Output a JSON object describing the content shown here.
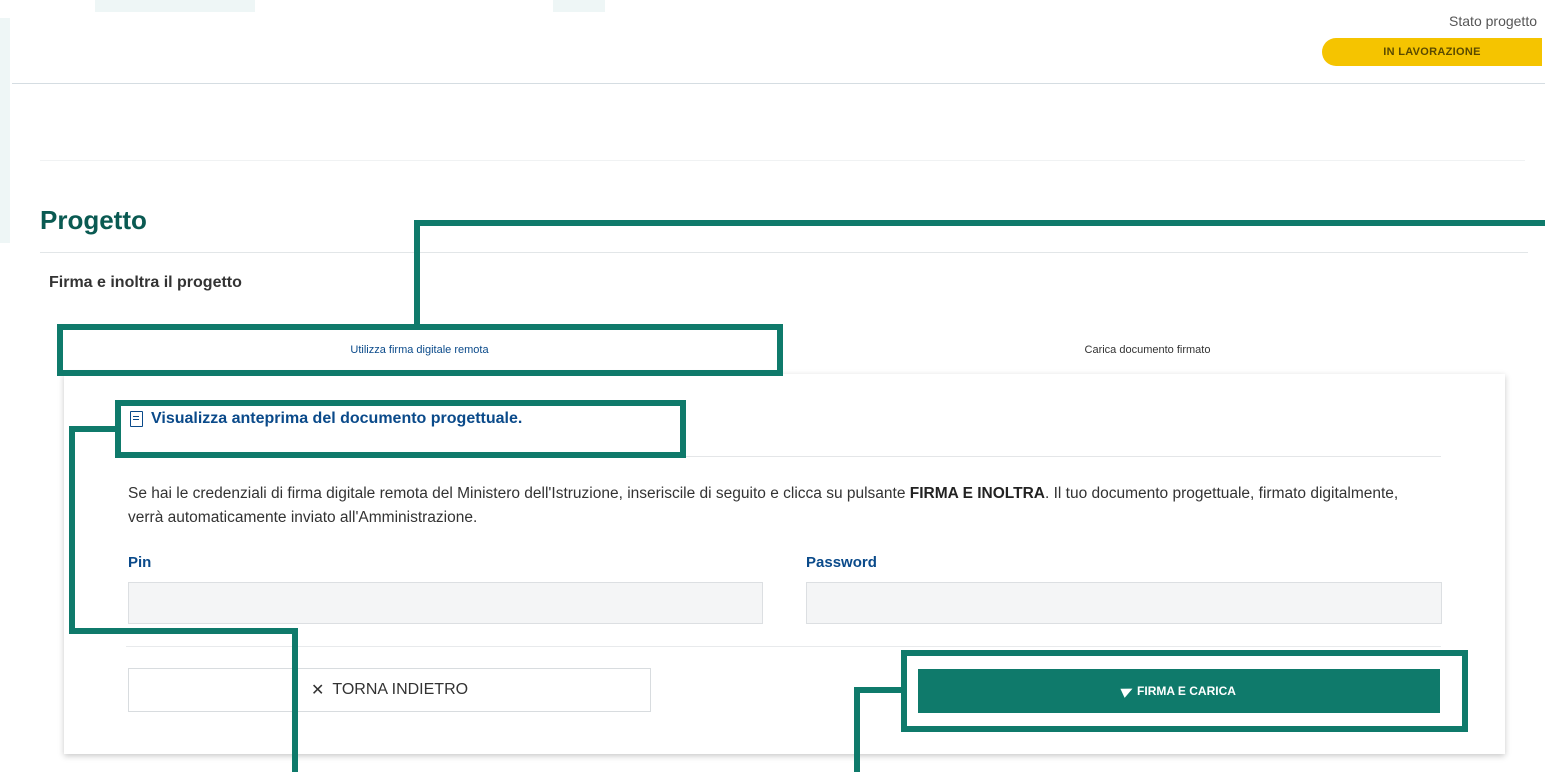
{
  "header": {
    "stato_label": "Stato progetto",
    "stato_value": "IN LAVORAZIONE",
    "stato_color": "#f5c400"
  },
  "page": {
    "title": "Progetto",
    "subtitle": "Firma e inoltra il progetto"
  },
  "tabs": [
    {
      "label": "Utilizza firma digitale remota",
      "active": true
    },
    {
      "label": "Carica documento firmato",
      "active": false
    }
  ],
  "card": {
    "preview_icon": "document-icon",
    "preview_link": "Visualizza anteprima del documento progettuale.",
    "description": {
      "part1": "Se hai le credenziali di firma digitale remota del Ministero dell'Istruzione, inseriscile di seguito e clicca su pulsante ",
      "bold1": "FIRMA E INOLTRA",
      "part2": ". Il tuo documento progettuale, firmato digitalmente, verrà automaticamente inviato all'Amministrazione."
    },
    "fields": {
      "pin_label": "Pin",
      "pin_value": "",
      "password_label": "Password",
      "password_value": ""
    },
    "buttons": {
      "back_label": "TORNA INDIETRO",
      "back_icon": "close-icon",
      "back_glyph": "✕",
      "sign_label": "FIRMA E CARICA",
      "sign_icon": "send-icon"
    }
  },
  "colors": {
    "accent": "#0f7a6b",
    "title": "#0a5a52",
    "link": "#0a4a8a"
  }
}
